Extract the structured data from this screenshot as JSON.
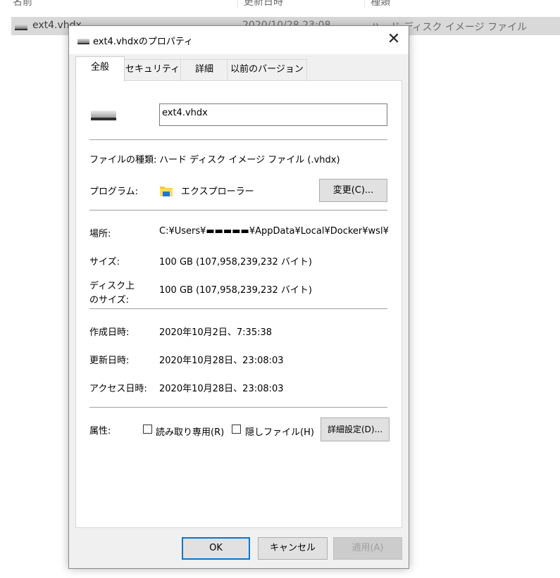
{
  "explorer": {
    "headers": {
      "name": "名前",
      "modified": "更新日時",
      "type": "種類"
    },
    "file": {
      "name": "ext4.vhdx",
      "modified": "2020/10/28 23:08",
      "type": "ハード ディスク イメージ ファイル"
    }
  },
  "dialog": {
    "title": "ext4.vhdxのプロパティ",
    "close_glyph": "✕",
    "tabs": [
      "全般",
      "セキュリティ",
      "詳細",
      "以前のバージョン"
    ],
    "active_tab": "全般",
    "filename_value": "ext4.vhdx",
    "file_type": {
      "label": "ファイルの種類:",
      "value": "ハード ディスク イメージ ファイル (.vhdx)"
    },
    "program": {
      "label": "プログラム:",
      "value": "エクスプローラー",
      "change_button": "変更(C)..."
    },
    "location": {
      "label": "場所:",
      "value": "C:¥Users¥▬▬▬▬▬¥AppData¥Local¥Docker¥wsl¥data"
    },
    "size": {
      "label": "サイズ:",
      "value": "100 GB (107,958,239,232 バイト)"
    },
    "disk_size": {
      "label_line1": "ディスク上",
      "label_line2": "のサイズ:",
      "value": "100 GB (107,958,239,232 バイト)"
    },
    "created": {
      "label": "作成日時:",
      "value": "2020年10月2日、7:35:38"
    },
    "modified": {
      "label": "更新日時:",
      "value": "2020年10月28日、23:08:03"
    },
    "accessed": {
      "label": "アクセス日時:",
      "value": "2020年10月28日、23:08:03"
    },
    "attributes": {
      "label": "属性:",
      "readonly": {
        "label": "読み取り専用(R)",
        "checked": false
      },
      "hidden": {
        "label": "隠しファイル(H)",
        "checked": false
      },
      "advanced_button": "詳細設定(D)..."
    },
    "buttons": {
      "ok": "OK",
      "cancel": "キャンセル",
      "apply": "適用(A)"
    }
  },
  "colors": {
    "accent": "#0078d7",
    "selection": "#d9d9d9"
  }
}
